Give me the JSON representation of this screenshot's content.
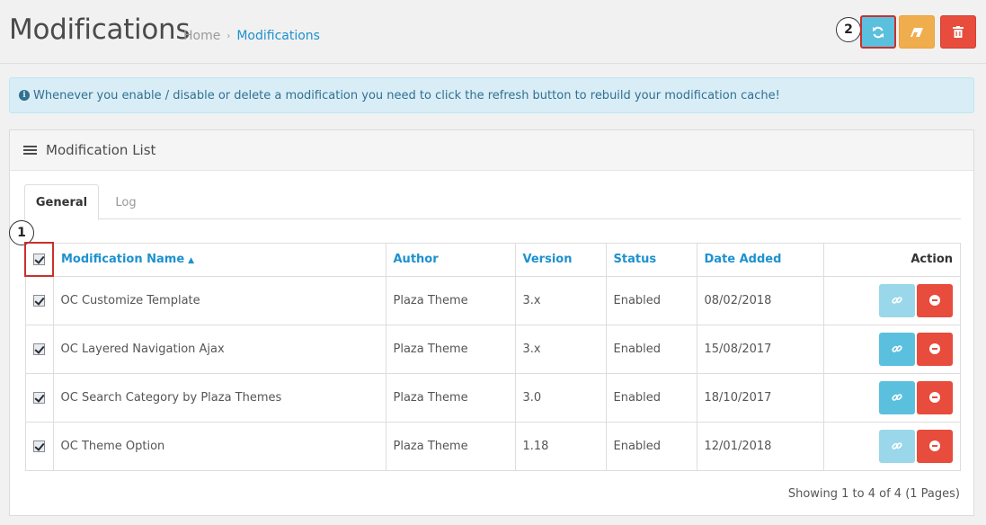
{
  "header": {
    "title": "Modifications",
    "breadcrumb": {
      "home": "Home",
      "separator": "›",
      "current": "Modifications"
    },
    "buttons": {
      "refresh_icon": "refresh-icon",
      "clear_icon": "eraser-icon",
      "delete_icon": "trash-icon"
    }
  },
  "markers": {
    "one": "1",
    "two": "2"
  },
  "alert": {
    "icon": "info-circle-icon",
    "text": "Whenever you enable / disable or delete a modification you need to click the refresh button to rebuild your modification cache!"
  },
  "panel": {
    "heading_icon": "list-icon",
    "heading": "Modification List",
    "tabs": [
      {
        "label": "General"
      },
      {
        "label": "Log"
      }
    ]
  },
  "table": {
    "columns": {
      "name": "Modification Name",
      "author": "Author",
      "version": "Version",
      "status": "Status",
      "date_added": "Date Added",
      "action": "Action"
    },
    "rows": [
      {
        "name": "OC Customize Template",
        "author": "Plaza Theme",
        "version": "3.x",
        "status": "Enabled",
        "date_added": "08/02/2018",
        "link_enabled": false
      },
      {
        "name": "OC Layered Navigation Ajax",
        "author": "Plaza Theme",
        "version": "3.x",
        "status": "Enabled",
        "date_added": "15/08/2017",
        "link_enabled": true
      },
      {
        "name": "OC Search Category by Plaza Themes",
        "author": "Plaza Theme",
        "version": "3.0",
        "status": "Enabled",
        "date_added": "18/10/2017",
        "link_enabled": true
      },
      {
        "name": "OC Theme Option",
        "author": "Plaza Theme",
        "version": "1.18",
        "status": "Enabled",
        "date_added": "12/01/2018",
        "link_enabled": false
      }
    ]
  },
  "pagination": {
    "text": "Showing 1 to 4 of 4 (1 Pages)"
  },
  "colors": {
    "primary": "#1e91cf",
    "info": "#5bc0de",
    "warning": "#f0ad4e",
    "danger": "#e74c3c",
    "highlight": "#c9302c"
  }
}
